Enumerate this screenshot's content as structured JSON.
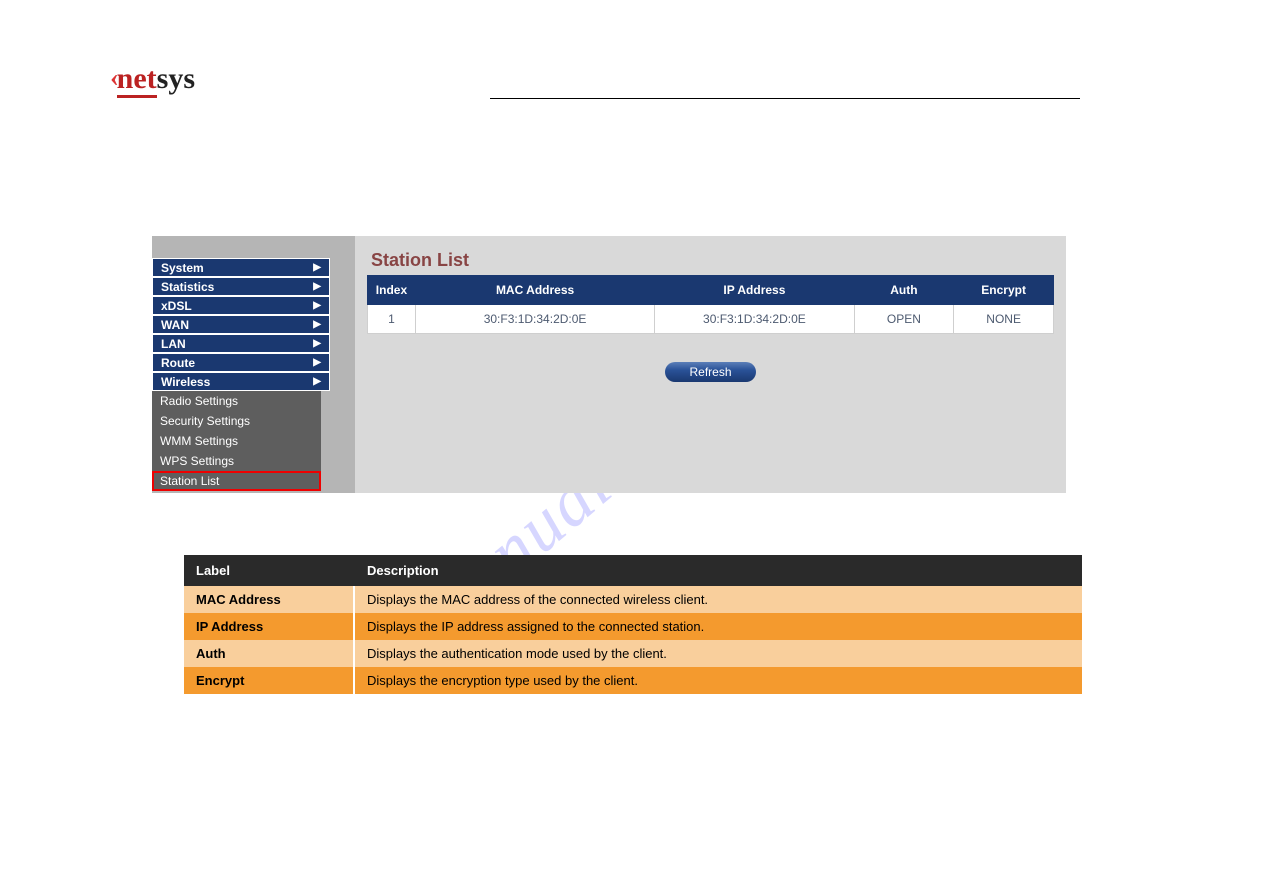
{
  "logo": {
    "prefix": "‹",
    "part1": "net",
    "part2": "sys"
  },
  "sidebar": {
    "items": [
      {
        "label": "System"
      },
      {
        "label": "Statistics"
      },
      {
        "label": "xDSL"
      },
      {
        "label": "WAN"
      },
      {
        "label": "LAN"
      },
      {
        "label": "Route"
      },
      {
        "label": "Wireless"
      }
    ],
    "sub_items": [
      {
        "label": "Radio Settings"
      },
      {
        "label": "Security Settings"
      },
      {
        "label": "WMM Settings"
      },
      {
        "label": "WPS Settings"
      },
      {
        "label": "Station List"
      }
    ]
  },
  "content": {
    "title": "Station List",
    "table": {
      "headers": [
        "Index",
        "MAC Address",
        "IP Address",
        "Auth",
        "Encrypt"
      ],
      "rows": [
        {
          "index": "1",
          "mac": "30:F3:1D:34:2D:0E",
          "ip": "30:F3:1D:34:2D:0E",
          "auth": "OPEN",
          "encrypt": "NONE"
        }
      ]
    },
    "refresh_label": "Refresh"
  },
  "desc_table": {
    "headers": [
      "Label",
      "Description"
    ],
    "rows": [
      {
        "label": "MAC Address",
        "desc": "Displays the MAC address of the connected wireless client."
      },
      {
        "label": "IP Address",
        "desc": "Displays the IP address assigned to the connected station."
      },
      {
        "label": "Auth",
        "desc": "Displays the authentication mode used by the client."
      },
      {
        "label": "Encrypt",
        "desc": "Displays the encryption type used by the client."
      }
    ]
  },
  "watermark": "manualshive.com"
}
